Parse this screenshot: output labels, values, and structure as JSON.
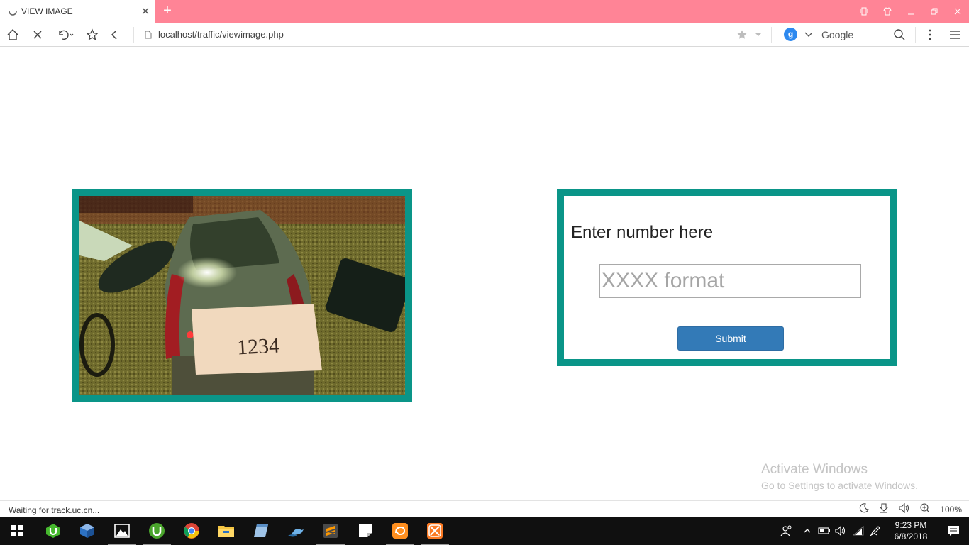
{
  "browser": {
    "tab_title": "VIEW IMAGE",
    "new_tab_label": "+",
    "address": "localhost/traffic/viewimage.php",
    "search_engine_badge": "g",
    "search_placeholder": "Google"
  },
  "page": {
    "form_heading": "Enter number here",
    "input_value": "",
    "input_placeholder": "XXXX format",
    "submit_label": "Submit",
    "plate_text": "1234"
  },
  "watermark": {
    "line1": "Activate Windows",
    "line2": "Go to Settings to activate Windows."
  },
  "status": {
    "text": "Waiting for track.uc.cn...",
    "zoom": "100%"
  },
  "taskbar": {
    "time": "9:23 PM",
    "date": "6/8/2018",
    "apps": [
      "start-icon",
      "utorrent-alt-icon",
      "virtualbox-icon",
      "photos-icon",
      "utorrent-icon",
      "chrome-icon",
      "file-explorer-icon",
      "notepad-icon",
      "python-icon",
      "sublime-text-icon",
      "sticky-notes-icon",
      "uc-browser-icon",
      "xampp-icon"
    ]
  },
  "colors": {
    "tab_strip": "#ff8496",
    "frame_teal": "#0a9588",
    "submit_blue": "#337ab7"
  }
}
